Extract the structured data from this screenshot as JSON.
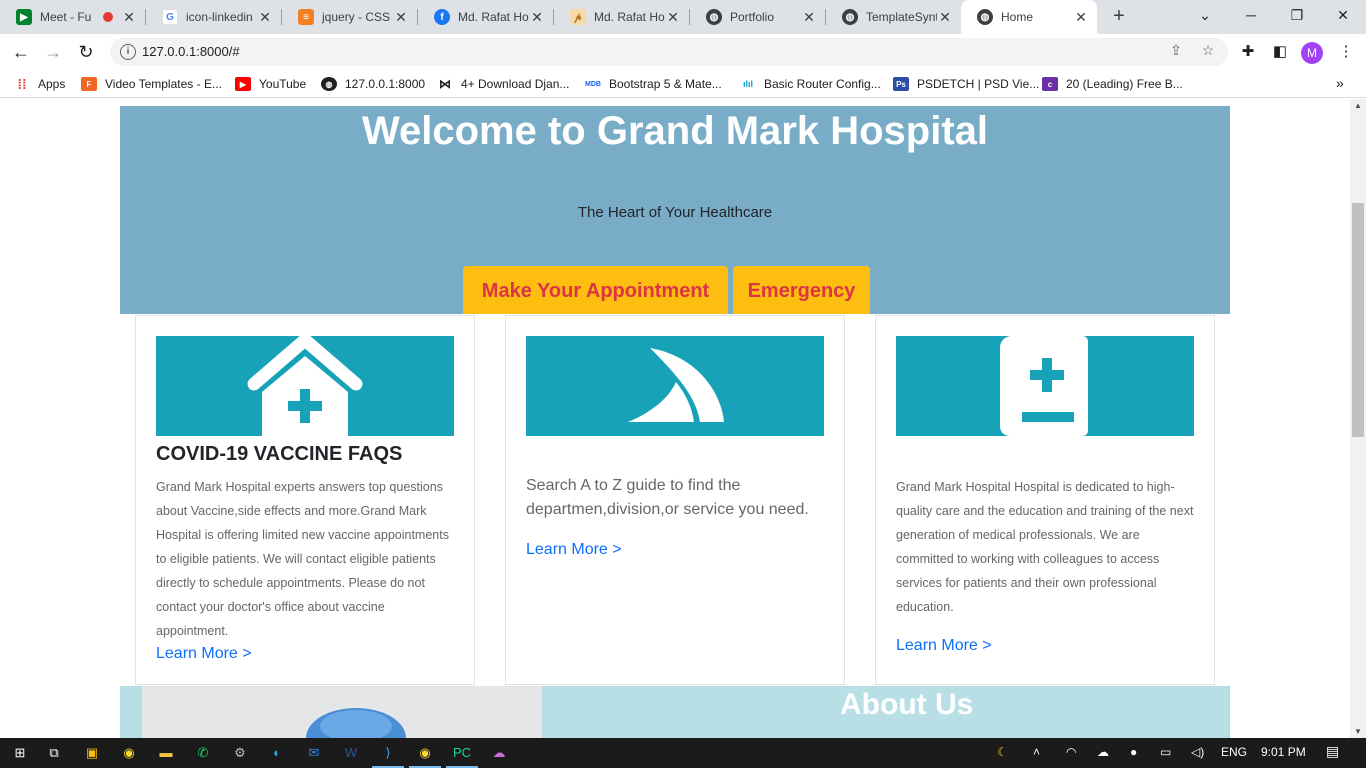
{
  "browser": {
    "tabs": [
      {
        "title": "Meet - Fu",
        "favicon": "google-meet-icon",
        "color": "#00832d",
        "left": 0
      },
      {
        "title": "icon-linkedin",
        "favicon": "google-icon",
        "color": "#4285f4"
      },
      {
        "title": "jquery - CSS c",
        "favicon": "stackoverflow-icon",
        "color": "#f48024"
      },
      {
        "title": "Md. Rafat Ho",
        "favicon": "facebook-icon",
        "color": "#1877f2"
      },
      {
        "title": "Md. Rafat Ho",
        "favicon": "portfolio-icon",
        "color": "#e0a050"
      },
      {
        "title": "Portfolio",
        "favicon": "globe-icon",
        "color": "#5f6368"
      },
      {
        "title": "TemplateSynt",
        "favicon": "globe-icon",
        "color": "#5f6368"
      },
      {
        "title": "Home",
        "favicon": "globe-icon",
        "color": "#5f6368"
      }
    ],
    "url": "127.0.0.1:8000/#",
    "profile_initial": "M",
    "bookmarks": [
      {
        "label": "Apps",
        "icon": "apps-grid-icon",
        "color": "#e8453c"
      },
      {
        "label": "Video Templates - E...",
        "icon": "envato-icon",
        "color": "#f26522"
      },
      {
        "label": "YouTube",
        "icon": "youtube-icon",
        "color": "#ff0000"
      },
      {
        "label": "127.0.0.1:8000",
        "icon": "globe-icon",
        "color": "#202124"
      },
      {
        "label": "4+ Download Djan...",
        "icon": "bowtie-icon",
        "color": "#202124"
      },
      {
        "label": "Bootstrap 5 & Mate...",
        "icon": "mdb-icon",
        "color": "#1266f1"
      },
      {
        "label": "Basic Router Config...",
        "icon": "cisco-icon",
        "color": "#049fd9"
      },
      {
        "label": "PSDETCH | PSD Vie...",
        "icon": "photoshop-icon",
        "color": "#2b4fa8"
      },
      {
        "label": "20 (Leading) Free B...",
        "icon": "colorlib-icon",
        "color": "#6b2fa8"
      }
    ]
  },
  "hero": {
    "title": "Welcome to Grand Mark Hospital",
    "subtitle": "The Heart of Your Healthcare",
    "appointment_label": "Make Your Appointment",
    "emergency_label": "Emergency"
  },
  "cards": [
    {
      "icon": "hospital-icon",
      "title": "COVID-19 VACCINE FAQS",
      "text": "Grand Mark Hospital experts answers top questions about Vaccine,side effects and more.Grand Mark Hospital is offering limited new vaccine appointments to eligible patients. We will contact eligible patients directly to schedule appointments. Please do not contact your doctor's office about vaccine appointment.",
      "link": "Learn More >"
    },
    {
      "icon": "shark-fin-icon",
      "title": "",
      "text": "Search A to Z guide to find the departmen,division,or service you need.",
      "link": "Learn More >"
    },
    {
      "icon": "medical-book-icon",
      "title": "",
      "text": "Grand Mark Hospital Hospital is dedicated to high-quality care and the education and training of the next generation of medical professionals. We are committed to working with colleagues to access services for patients and their own professional education.",
      "link": "Learn More >"
    }
  ],
  "about": {
    "title": "About Us"
  },
  "taskbar": {
    "language": "ENG",
    "time": "9:01 PM"
  },
  "colors": {
    "hero_bg": "#79adc7",
    "button_bg": "#fdbe10",
    "button_text": "#dc3545",
    "banner_bg": "#17a2b8",
    "link": "#0d6efd",
    "about_bg": "#b8dfe5"
  }
}
